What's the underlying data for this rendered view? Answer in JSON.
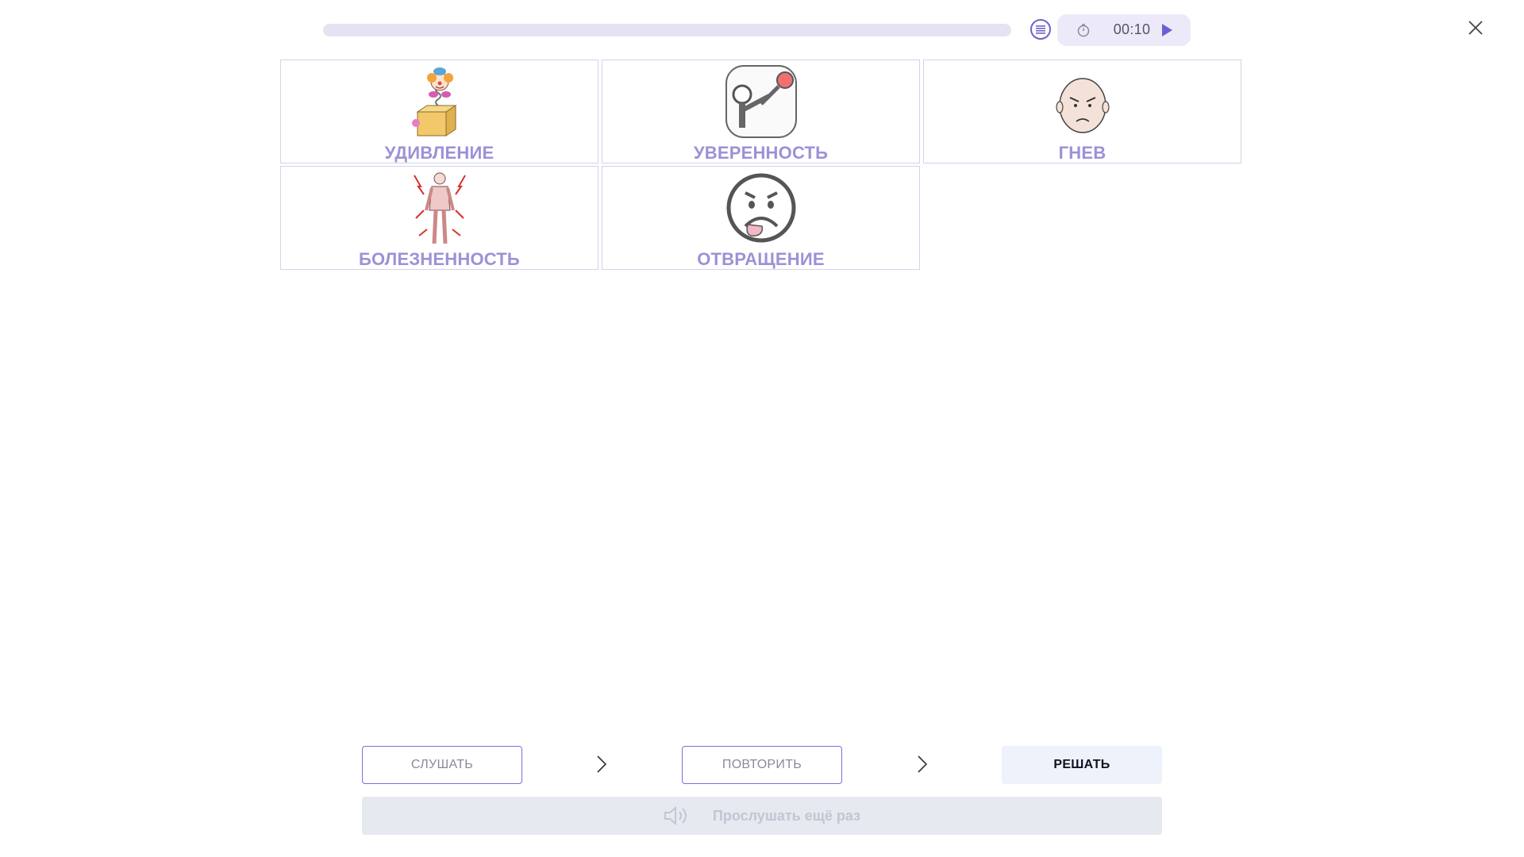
{
  "progress": {
    "value": 0
  },
  "timer": {
    "time": "00:10",
    "clock_icon": "timer-icon",
    "play_icon": "play-icon"
  },
  "header": {
    "list_icon": "list-icon",
    "close_icon": "close-icon"
  },
  "cards": [
    {
      "label": "УДИВЛЕНИЕ",
      "icon": "clown-in-box-icon"
    },
    {
      "label": "УВЕРЕННОСТЬ",
      "icon": "confident-person-icon"
    },
    {
      "label": "ГНЕВ",
      "icon": "angry-face-icon"
    },
    {
      "label": "БОЛЕЗНЕННОСТЬ",
      "icon": "body-pain-icon"
    },
    {
      "label": "ОТВРАЩЕНИЕ",
      "icon": "disgust-face-icon"
    }
  ],
  "steps": [
    {
      "label": "СЛУШАТЬ"
    },
    {
      "label": "ПОВТОРИТЬ"
    },
    {
      "label": "РЕШАТЬ"
    }
  ],
  "listen_again": {
    "label": "Прослушать ещё раз",
    "icon": "speaker-icon"
  },
  "colors": {
    "accent": "#7d70d6",
    "label": "#9e90d6",
    "active_step_bg": "#edf2fb",
    "disabled_bg": "#e6e9f0"
  }
}
